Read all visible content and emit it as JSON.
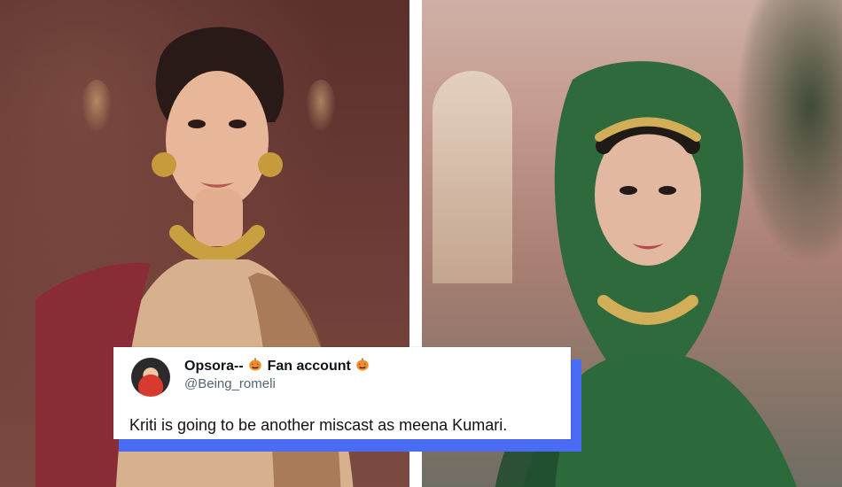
{
  "left_photo": {
    "alt": ""
  },
  "right_photo": {
    "alt": ""
  },
  "tweet": {
    "display_name_prefix": "Opsora--",
    "display_name_middle": " Fan account ",
    "handle": "@Being_romeli",
    "text": "Kriti is going to be another miscast as meena Kumari.",
    "icons": [
      "pumpkin-icon",
      "pumpkin-icon"
    ],
    "accent_color": "#4a6cf5"
  }
}
